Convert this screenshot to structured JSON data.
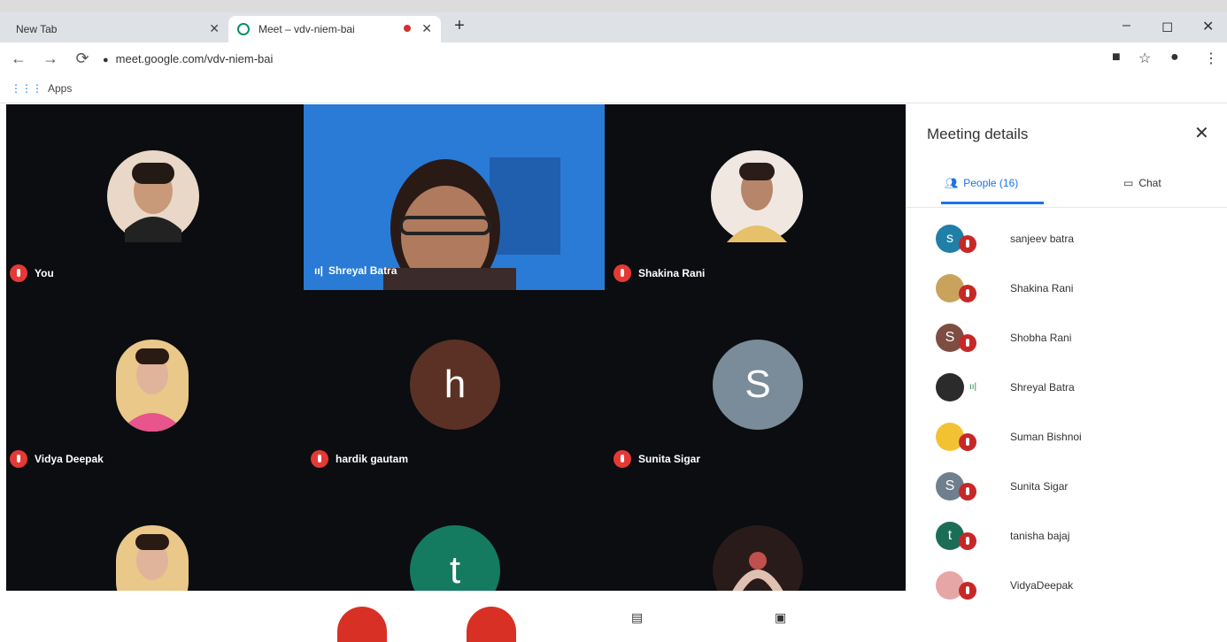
{
  "browser": {
    "tabs": [
      {
        "label": "New Tab"
      },
      {
        "label": "Meet – vdv-niem-bai"
      }
    ],
    "url": "meet.google.com/vdv-niem-bai",
    "bookmarks_label": "Apps",
    "window_controls": {
      "minimize": "–",
      "maximize": "◻",
      "close": "✕"
    }
  },
  "tiles": [
    {
      "name": "You",
      "kind": "photo",
      "color": "#e9d8c8"
    },
    {
      "name": "Shreyal Batra",
      "kind": "video"
    },
    {
      "name": "Shakina Rani",
      "kind": "photo",
      "color": "#e7c06a"
    },
    {
      "name": "Vidya Deepak",
      "kind": "photo",
      "color": "#e8a2b2"
    },
    {
      "name": "hardik gautam",
      "kind": "letter",
      "letter": "h",
      "color": "#5b3125"
    },
    {
      "name": "Sunita Sigar",
      "kind": "letter",
      "letter": "S",
      "color": "#7a8b99"
    },
    {
      "name": "",
      "kind": "photo",
      "color": "#e8a2b2"
    },
    {
      "name": "",
      "kind": "letter",
      "letter": "t",
      "color": "#147a60"
    },
    {
      "name": "",
      "kind": "photo",
      "color": "#3b2a2a"
    }
  ],
  "panel": {
    "title": "Meeting details",
    "tabs": {
      "people": "People (16)",
      "chat": "Chat"
    },
    "people": [
      {
        "name": "sanjeev batra",
        "initial": "s",
        "color": "#1f7fa6"
      },
      {
        "name": "Shakina Rani",
        "initial": "",
        "color": "#c9a25c"
      },
      {
        "name": "Shobha Rani",
        "initial": "S",
        "color": "#7d4d42"
      },
      {
        "name": "Shreyal Batra",
        "initial": "",
        "color": "#2b2b2b"
      },
      {
        "name": "Suman Bishnoi",
        "initial": "",
        "color": "#f2c233"
      },
      {
        "name": "Sunita Sigar",
        "initial": "S",
        "color": "#6f7f8d"
      },
      {
        "name": "tanisha bajaj",
        "initial": "t",
        "color": "#1b6e55"
      },
      {
        "name": "VidyaDeepak",
        "initial": "",
        "color": "#e6a6a6"
      }
    ]
  },
  "colors": {
    "accent": "#1a73e8",
    "stage_bg": "#0b0d10",
    "mute_red": "#e53935"
  }
}
